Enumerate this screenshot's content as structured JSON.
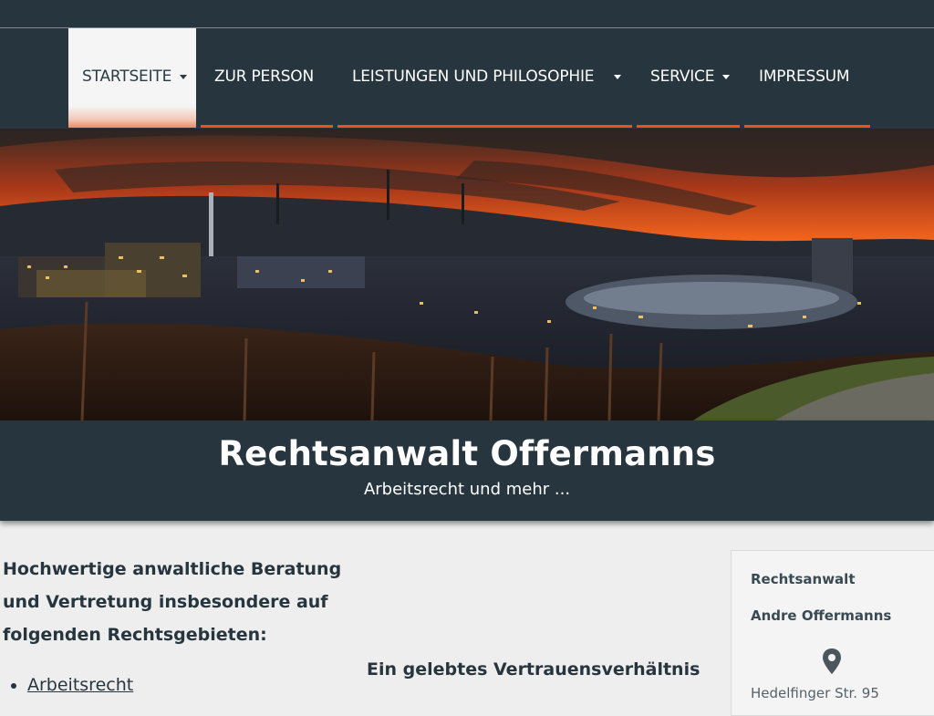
{
  "nav": {
    "items": [
      {
        "label": "STARTSEITE",
        "has_dropdown": true,
        "active": true
      },
      {
        "label": "ZUR PERSON",
        "has_dropdown": false,
        "active": false
      },
      {
        "label": "LEISTUNGEN UND PHILOSOPHIE",
        "has_dropdown": true,
        "active": false
      },
      {
        "label": "SERVICE",
        "has_dropdown": true,
        "active": false
      },
      {
        "label": "IMPRESSUM",
        "has_dropdown": false,
        "active": false
      }
    ]
  },
  "header": {
    "title": "Rechtsanwalt Offermanns",
    "subtitle": "Arbeitsrecht und mehr ..."
  },
  "main": {
    "intro": "Hochwertige anwaltliche Beratung und Vertretung insbesondere auf folgenden Rechtsgebieten:",
    "rechtsgebiete": [
      "Arbeitsrecht"
    ],
    "trust_heading": "Ein gelebtes Vertrauensverhältnis"
  },
  "sidebar": {
    "line1": "Rechtsanwalt",
    "line2": "Andre Offermanns",
    "address": "Hedelfinger Str. 95",
    "pin_icon": "map-pin-icon"
  },
  "colors": {
    "dark": "#27363e",
    "accent": "#e8531f",
    "background": "#eeeeee"
  }
}
